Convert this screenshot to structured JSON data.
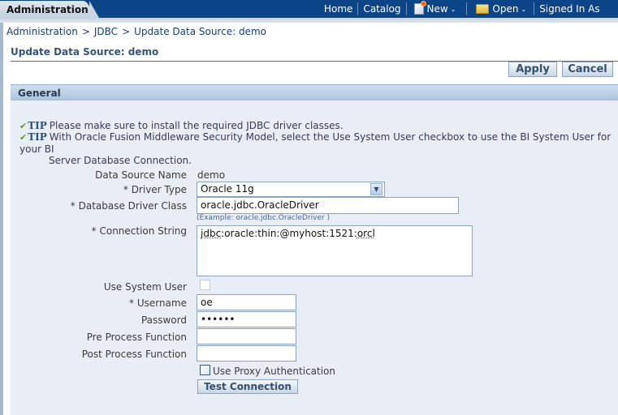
{
  "header": {
    "active_tab": "Administration",
    "nav": {
      "home": "Home",
      "catalog": "Catalog",
      "new": "New",
      "open": "Open",
      "signed_in": "Signed In As"
    }
  },
  "breadcrumb": {
    "items": [
      "Administration",
      "JDBC",
      "Update Data Source: demo"
    ],
    "separator": ">"
  },
  "page": {
    "title": "Update Data Source: demo",
    "apply_label": "Apply",
    "cancel_label": "Cancel"
  },
  "section": {
    "title": "General",
    "tips": [
      {
        "label": "TIP",
        "text": "Please make sure to install the required JDBC driver classes."
      },
      {
        "label": "TIP",
        "text": "With Oracle Fusion Middleware Security Model, select the Use System User checkbox to use the BI System User for your BI",
        "cont": "Server Database Connection."
      }
    ]
  },
  "form": {
    "data_source_name": {
      "label": "Data Source Name",
      "value": "demo"
    },
    "driver_type": {
      "label": "* Driver Type",
      "value": "Oracle 11g"
    },
    "driver_class": {
      "label": "* Database Driver Class",
      "value": "oracle.jdbc.OracleDriver",
      "hint": "(Example: oracle.jdbc.OracleDriver )"
    },
    "connection_string": {
      "label": "* Connection String",
      "value_parts": [
        "jdbc",
        ":oracle:thin:@myhost:1521:",
        "orcl"
      ]
    },
    "use_system_user": {
      "label": "Use System User",
      "checked": false
    },
    "username": {
      "label": "* Username",
      "value": "oe"
    },
    "password": {
      "label": "Password",
      "value": "••••••"
    },
    "pre_process": {
      "label": "Pre Process Function",
      "value": ""
    },
    "post_process": {
      "label": "Post Process Function",
      "value": ""
    },
    "use_proxy": {
      "label": "Use Proxy Authentication",
      "checked": false
    },
    "test_connection_label": "Test Connection"
  }
}
